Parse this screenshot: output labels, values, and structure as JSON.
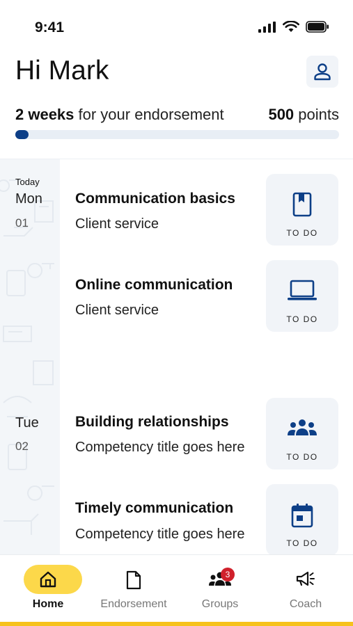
{
  "status_bar": {
    "time": "9:41"
  },
  "header": {
    "greeting": "Hi Mark",
    "progress_weeks": "2 weeks",
    "progress_text": " for your endorsement",
    "points_value": "500",
    "points_label": " points",
    "progress_fraction": 0.04
  },
  "days": [
    {
      "tag": "Today",
      "name": "Mon",
      "num": "01"
    },
    {
      "tag": "",
      "name": "Tue",
      "num": "02"
    }
  ],
  "lessons": [
    {
      "title": "Communication basics",
      "subtitle": "Client service",
      "status": "TO DO",
      "icon": "book-icon"
    },
    {
      "title": "Online communication",
      "subtitle": "Client service",
      "status": "TO DO",
      "icon": "laptop-icon"
    },
    {
      "title": "Building relationships",
      "subtitle": "Competency title goes here",
      "status": "TO DO",
      "icon": "group-icon"
    },
    {
      "title": "Timely communication",
      "subtitle": "Competency title goes here",
      "status": "TO DO",
      "icon": "calendar-icon"
    }
  ],
  "nav": [
    {
      "label": "Home",
      "icon": "home-icon",
      "active": true
    },
    {
      "label": "Endorsement",
      "icon": "document-icon",
      "active": false
    },
    {
      "label": "Groups",
      "icon": "groups-icon",
      "active": false,
      "badge": "3"
    },
    {
      "label": "Coach",
      "icon": "megaphone-icon",
      "active": false
    }
  ],
  "colors": {
    "accent_blue": "#0d3f87",
    "accent_yellow": "#fcd84a",
    "badge_red": "#d0202b",
    "card_bg": "#f1f4f8"
  }
}
